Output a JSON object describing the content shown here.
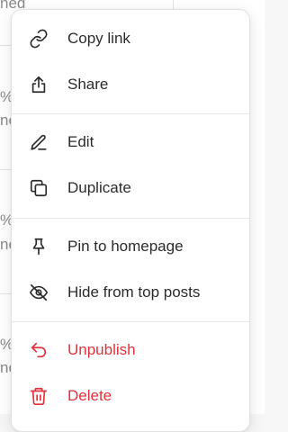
{
  "background": {
    "fragments": [
      "ned",
      "%",
      "ne",
      "%",
      "ne",
      "%",
      "ne"
    ]
  },
  "menu": {
    "groups": [
      {
        "items": [
          {
            "label": "Copy link",
            "icon": "link-icon"
          },
          {
            "label": "Share",
            "icon": "share-icon"
          }
        ]
      },
      {
        "items": [
          {
            "label": "Edit",
            "icon": "pencil-icon"
          },
          {
            "label": "Duplicate",
            "icon": "duplicate-icon"
          }
        ]
      },
      {
        "items": [
          {
            "label": "Pin to homepage",
            "icon": "pin-icon"
          },
          {
            "label": "Hide from top posts",
            "icon": "eye-off-icon"
          }
        ]
      },
      {
        "items": [
          {
            "label": "Unpublish",
            "icon": "undo-arrow-icon"
          },
          {
            "label": "Delete",
            "icon": "trash-icon"
          }
        ]
      }
    ]
  },
  "colors": {
    "text": "#2b2b2b",
    "danger": "#e0323c",
    "divider": "#e6e6e6"
  }
}
